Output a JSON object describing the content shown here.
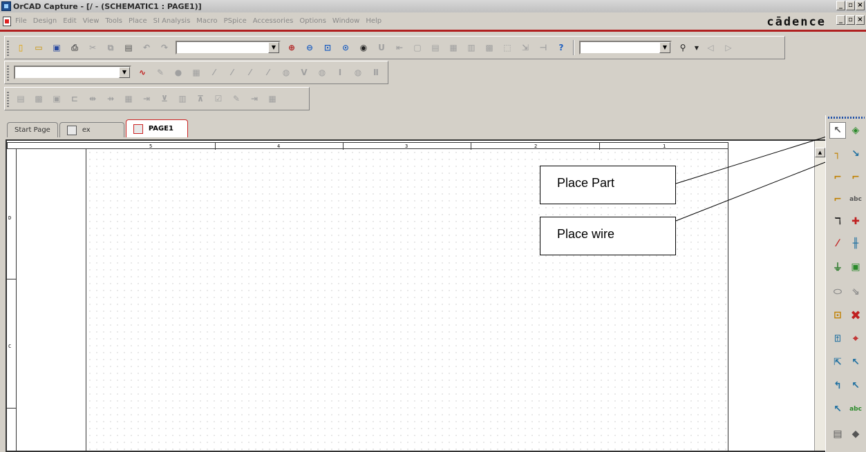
{
  "window": {
    "title": "OrCAD Capture - [/ - (SCHEMATIC1 : PAGE1)]",
    "controls": [
      "_",
      "̅",
      "×"
    ]
  },
  "menu": {
    "items": [
      "File",
      "Design",
      "Edit",
      "View",
      "Tools",
      "Place",
      "SI Analysis",
      "Macro",
      "PSpice",
      "Accessories",
      "Options",
      "Window",
      "Help"
    ],
    "brand": "cādence"
  },
  "tabs": [
    {
      "label": "Start Page",
      "active": false
    },
    {
      "label": "ex",
      "active": false
    },
    {
      "label": "PAGE1",
      "active": true
    }
  ],
  "schematic": {
    "columns": [
      "5",
      "4",
      "3",
      "2",
      "1"
    ],
    "rows": [
      "D",
      "C"
    ]
  },
  "callouts": {
    "place_part": "Place Part",
    "place_wire": "Place wire"
  },
  "icons": {
    "toolbar1": [
      "new-icon",
      "open-icon",
      "save-icon",
      "print-icon",
      "cut-icon",
      "copy-icon",
      "paste-icon",
      "undo-icon",
      "redo-icon",
      "zoom-in-icon",
      "zoom-out-icon",
      "zoom-area-icon",
      "zoom-all-icon",
      "visible-icon",
      "annotate-icon",
      "back-annotate-icon",
      "drc-icon",
      "netlist-icon",
      "cross-reference-icon",
      "bom-icon",
      "snap-grid-icon",
      "area-select-icon",
      "drag-icon",
      "help-icon",
      "find-icon",
      "prev-icon",
      "next-icon"
    ],
    "toolbar2": [
      "new-simulation-icon",
      "edit-simulation-icon",
      "run-icon",
      "view-results-icon",
      "voltage-marker-icon",
      "diff-marker-icon",
      "current-marker-icon",
      "power-marker-icon",
      "bias-v-icon",
      "bias-i-icon",
      "bias-w-icon"
    ],
    "toolbar3": [
      "table-icon",
      "pin-icon",
      "net-icon",
      "connect-icon",
      "bus-icon",
      "busentry-icon",
      "part-edit-icon",
      "export-icon",
      "cart-icon",
      "properties-icon",
      "rules-icon",
      "check-icon",
      "netlist2-icon",
      "grid-icon"
    ],
    "palette": [
      "select-icon",
      "place-part-icon",
      "place-wire-icon",
      "place-net-alias-icon",
      "place-bus-icon",
      "place-junction-icon",
      "place-bus-entry-icon",
      "place-net-label-icon",
      "place-power-icon",
      "place-ground-icon",
      "place-hier-block-icon",
      "place-no-connect-icon",
      "place-port-icon",
      "place-pin-icon",
      "place-off-page-icon",
      "place-line-icon",
      "place-polyline-icon",
      "place-rectangle-icon",
      "place-ellipse-icon",
      "place-arc-icon",
      "place-elliptical-arc-icon",
      "place-bezier-icon",
      "place-text-icon",
      "place-pspice-part-icon",
      "place-ic-part-icon",
      "place-outline-icon"
    ]
  }
}
